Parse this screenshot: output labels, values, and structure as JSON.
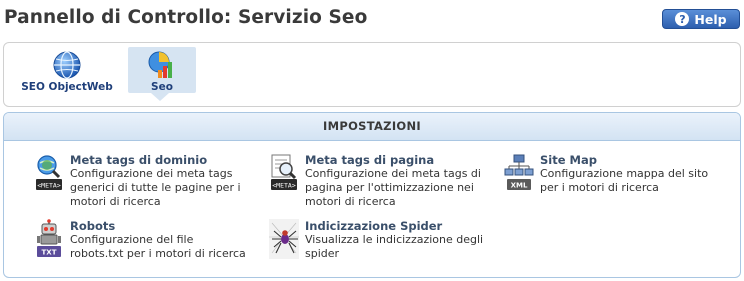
{
  "header": {
    "title": "Pannello di Controllo: Servizio Seo",
    "help_label": "Help"
  },
  "apps": {
    "tiles": [
      {
        "label": "SEO ObjectWeb",
        "icon": "globe-icon"
      },
      {
        "label": "Seo",
        "icon": "seo-chart-icon",
        "active": true
      }
    ]
  },
  "settings": {
    "title": "IMPOSTAZIONI",
    "items": [
      {
        "title": "Meta tags di dominio",
        "desc": "Configurazione dei meta tags generici di tutte le pagine per i motori di ricerca",
        "icon": "meta-domain-icon"
      },
      {
        "title": "Meta tags di pagina",
        "desc": "Configurazione dei meta tags di pagina per l'ottimizzazione nei motori di ricerca",
        "icon": "meta-page-icon"
      },
      {
        "title": "Site Map",
        "desc": "Configurazione mappa del sito per i motori di ricerca",
        "icon": "sitemap-xml-icon"
      },
      {
        "title": "Robots",
        "desc": "Configurazione del file robots.txt per i motori di ricerca",
        "icon": "robot-txt-icon"
      },
      {
        "title": "Indicizzazione Spider",
        "desc": "Visualizza le indicizzazione degli spider",
        "icon": "spider-icon"
      }
    ]
  },
  "colors": {
    "accent": "#2d5fae",
    "panel_border": "#a9c6e2",
    "active_tile": "#d6e4f2"
  }
}
